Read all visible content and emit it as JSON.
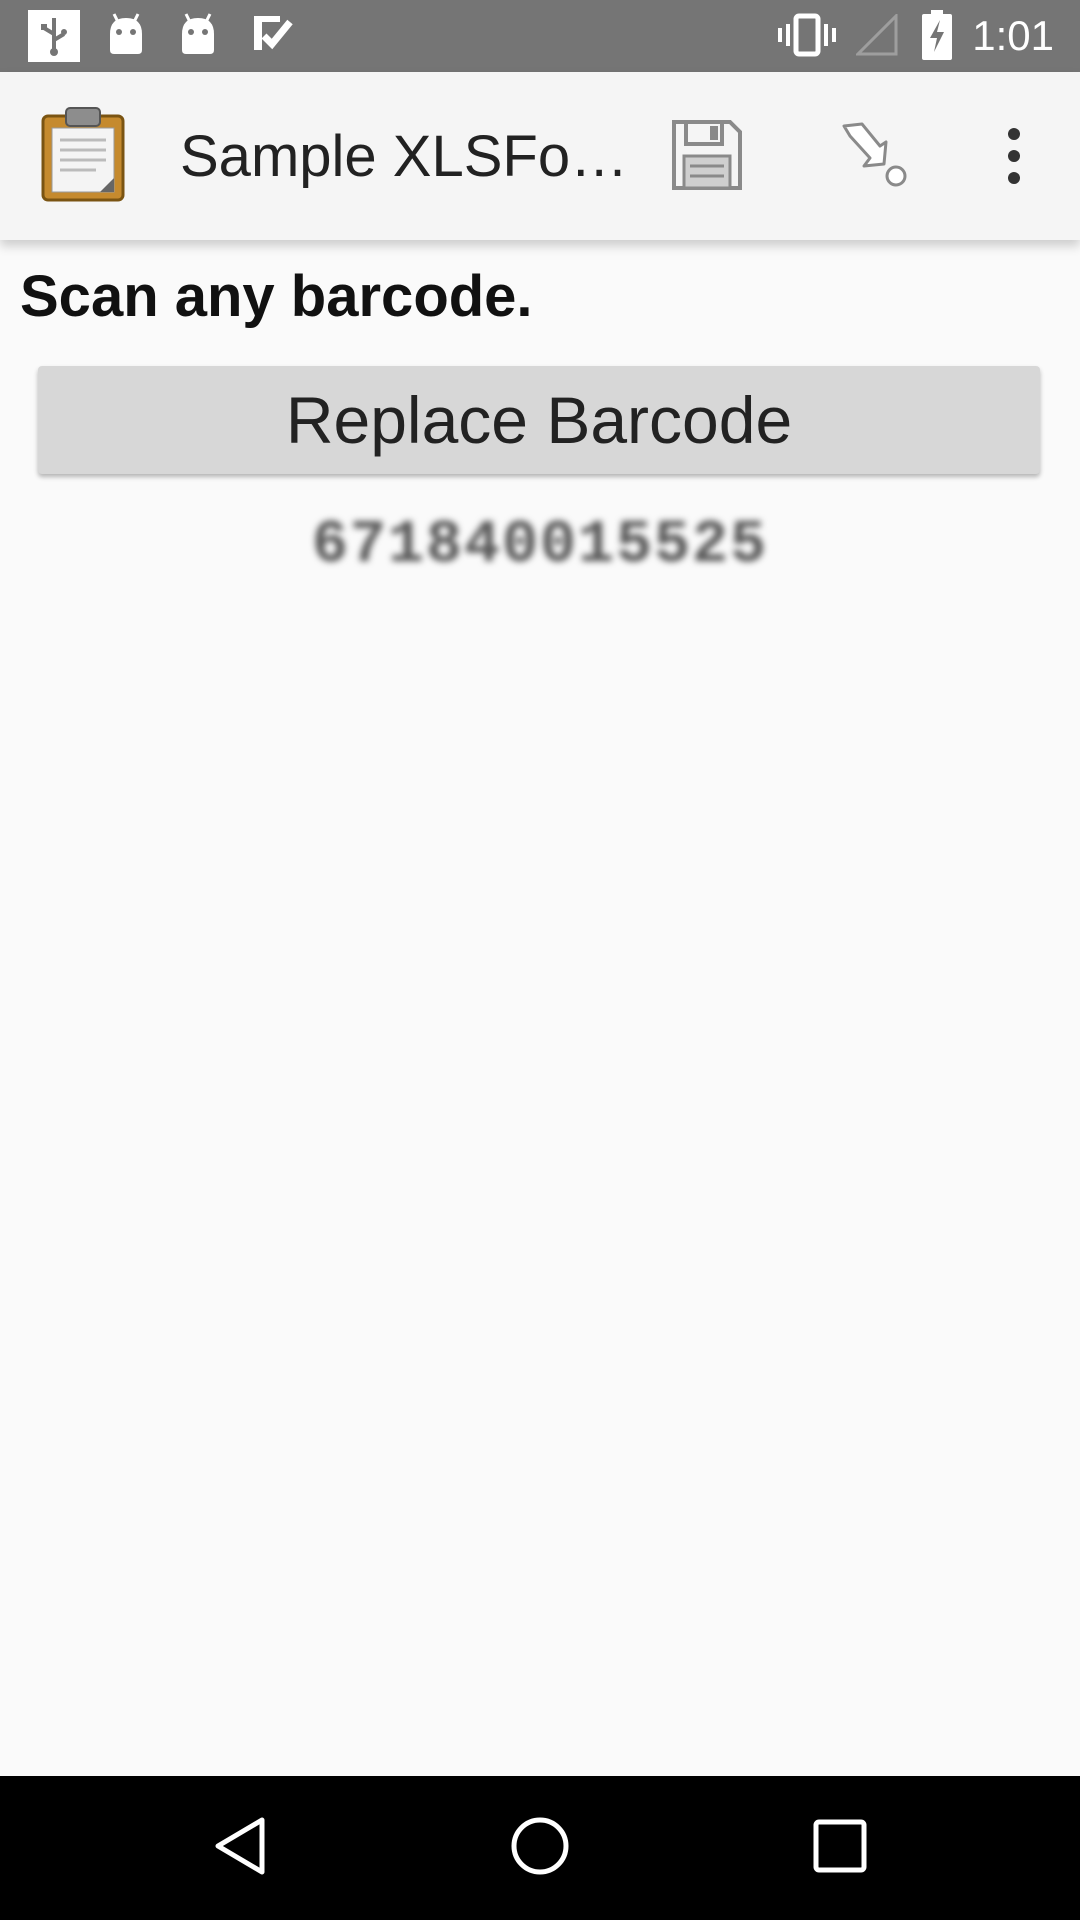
{
  "status_bar": {
    "time": "1:01",
    "icons": [
      "usb-icon",
      "android-icon",
      "android-icon",
      "check-icon",
      "vibrate-icon",
      "signal-icon",
      "battery-charging-icon"
    ]
  },
  "action_bar": {
    "title": "Sample XLSFo…",
    "app_icon": "clipboard-icon",
    "save_icon": "floppy-disk-icon",
    "goto_icon": "jump-arrow-icon",
    "overflow_icon": "more-vert-icon"
  },
  "question": {
    "label": "Scan any barcode.",
    "button_label": "Replace Barcode",
    "value": "671840015525"
  },
  "nav_bar": {
    "icons": [
      "back-icon",
      "home-icon",
      "recents-icon"
    ]
  },
  "colors": {
    "status_bar": "#757575",
    "action_bar": "#f5f5f5",
    "background": "#fafafa",
    "button": "#d7d7d7",
    "nav_bar": "#000000"
  }
}
